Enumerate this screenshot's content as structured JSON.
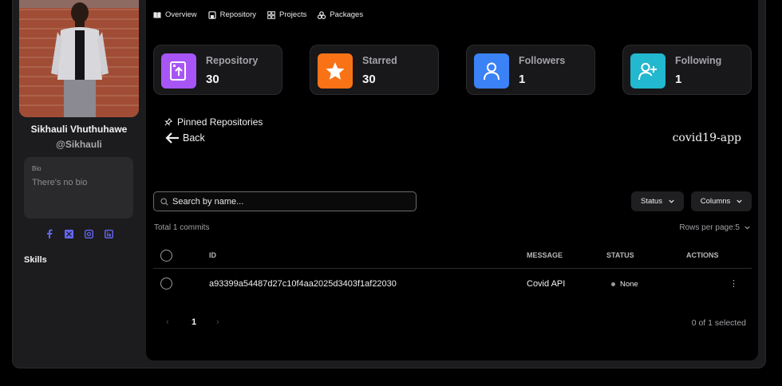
{
  "profile": {
    "name": "Sikhauli Vhuthuhawe",
    "handle": "@Sikhauli",
    "bio_label": "Bio",
    "bio_text": "There's no bio",
    "skills_label": "Skills",
    "socials": [
      "facebook-icon",
      "x-icon",
      "instagram-icon",
      "linkedin-icon"
    ]
  },
  "tabs": [
    {
      "label": "Overview",
      "icon": "book-icon"
    },
    {
      "label": "Repository",
      "icon": "repo-icon"
    },
    {
      "label": "Projects",
      "icon": "grid-icon"
    },
    {
      "label": "Packages",
      "icon": "package-icon"
    }
  ],
  "stats": [
    {
      "label": "Repository",
      "value": "30",
      "color": "#a855f7",
      "icon": "repo-upload-icon"
    },
    {
      "label": "Starred",
      "value": "30",
      "color": "#f97316",
      "icon": "star-icon"
    },
    {
      "label": "Followers",
      "value": "1",
      "color": "#3b82f6",
      "icon": "user-icon"
    },
    {
      "label": "Following",
      "value": "1",
      "color": "#22b8cf",
      "icon": "user-plus-icon"
    }
  ],
  "pinned_label": "Pinned Repositories",
  "back_label": "Back",
  "repo_name": "covid19-app",
  "search": {
    "placeholder": "Search by name..."
  },
  "filters": {
    "status_label": "Status",
    "columns_label": "Columns"
  },
  "total_commits": "Total 1 commits",
  "rows_per_page": "Rows per page:5",
  "table": {
    "headers": {
      "id": "ID",
      "message": "MESSAGE",
      "status": "STATUS",
      "actions": "ACTIONS"
    },
    "rows": [
      {
        "id": "a93399a54487d27c10f4aa2025d3403f1af22030",
        "message": "Covid API",
        "status": "None"
      }
    ]
  },
  "pagination": {
    "prev": "‹",
    "current": "1",
    "next": "›"
  },
  "selection": "0 of 1 selected"
}
